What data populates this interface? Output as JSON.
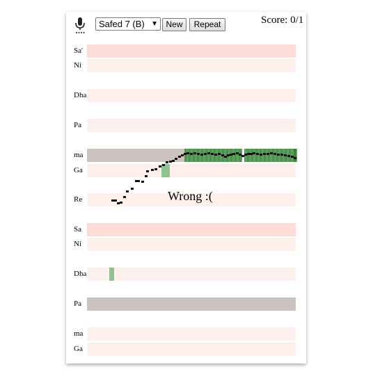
{
  "toolbar": {
    "mic_icon": "microphone-icon",
    "raga_select_value": "Safed 7 (B)",
    "new_label": "New",
    "repeat_label": "Repeat"
  },
  "score_text": "Score: 0/1",
  "feedback_text": "Wrong :(",
  "notes": [
    {
      "label": "Sa'",
      "state": "highlight"
    },
    {
      "label": "Ni",
      "state": "normal"
    },
    {
      "label": "Dha",
      "state": "normal"
    },
    {
      "label": "Pa",
      "state": "normal"
    },
    {
      "label": "ma",
      "state": "target"
    },
    {
      "label": "Ga",
      "state": "normal"
    },
    {
      "label": "Re",
      "state": "normal"
    },
    {
      "label": "Sa",
      "state": "highlight"
    },
    {
      "label": "Ni",
      "state": "normal"
    },
    {
      "label": "Dha",
      "state": "normal"
    },
    {
      "label": "Pa",
      "state": "target"
    },
    {
      "label": "ma",
      "state": "normal"
    },
    {
      "label": "Ga",
      "state": "normal"
    }
  ],
  "colors": {
    "lane_normal": "#fdf0ec",
    "lane_highlight": "#fcdcd5",
    "lane_target": "#cbc3c0",
    "sung_green": "#4f8f4f",
    "sung_light_green": "#8fc48f",
    "pitch_dot": "#111111"
  }
}
